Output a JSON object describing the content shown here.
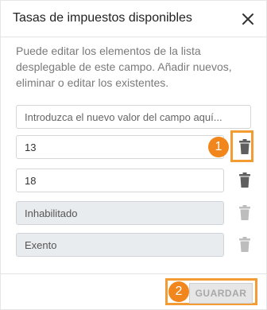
{
  "dialog": {
    "title": "Tasas de impuestos disponibles",
    "description": "Puede editar los elementos de la lista desplegable de este campo. Añadir nuevos, eliminar o editar los existentes."
  },
  "new_value_input": {
    "placeholder": "Introduzca el nuevo valor del campo aquí..."
  },
  "items": [
    {
      "value": "13",
      "disabled": false
    },
    {
      "value": "18",
      "disabled": false
    },
    {
      "value": "Inhabilitado",
      "disabled": true
    },
    {
      "value": "Exento",
      "disabled": true
    }
  ],
  "annotations": [
    "1",
    "2"
  ],
  "footer": {
    "save_label": "GUARDAR"
  },
  "colors": {
    "accent": "#f0861c",
    "trash_active": "#5f5f5f",
    "trash_disabled": "#bdbdbd",
    "disabled_field_bg": "#e9ecef"
  },
  "icons": {
    "close": "close-icon",
    "delete": "trash-icon"
  }
}
